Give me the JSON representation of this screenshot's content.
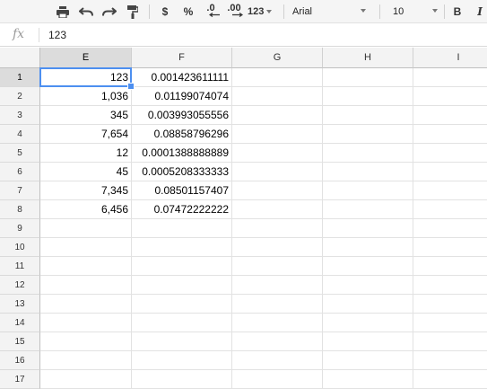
{
  "toolbar": {
    "currency_label": "$",
    "percent_label": "%",
    "decrease_decimal_label": ".0",
    "increase_decimal_label": ".00",
    "more_formats_label": "123",
    "font_family": "Arial",
    "font_size": "10",
    "bold_label": "B",
    "italic_label": "I",
    "icons": [
      "print-icon",
      "undo-icon",
      "redo-icon",
      "paint-format-icon",
      "caret-icon"
    ]
  },
  "formula_bar": {
    "fx_label": "fx",
    "value": "123"
  },
  "columns": [
    "E",
    "F",
    "G",
    "H",
    "I"
  ],
  "active_column": "E",
  "row_numbers": [
    "1",
    "2",
    "3",
    "4",
    "5",
    "6",
    "7",
    "8",
    "9",
    "10",
    "11",
    "12",
    "13",
    "14",
    "15",
    "16",
    "17"
  ],
  "active_row": "1",
  "rows": [
    {
      "E": "123",
      "F": "0.001423611111"
    },
    {
      "E": "1,036",
      "F": "0.01199074074"
    },
    {
      "E": "345",
      "F": "0.003993055556"
    },
    {
      "E": "7,654",
      "F": "0.08858796296"
    },
    {
      "E": "12",
      "F": "0.0001388888889"
    },
    {
      "E": "45",
      "F": "0.0005208333333"
    },
    {
      "E": "7,345",
      "F": "0.08501157407"
    },
    {
      "E": "6,456",
      "F": "0.07472222222"
    }
  ],
  "selected_cell": "E1",
  "colors": {
    "selection": "#4d8ff0",
    "header_bg": "#f3f3f3",
    "active_header_bg": "#dcdcdc",
    "gridline": "#e2e2e2"
  }
}
